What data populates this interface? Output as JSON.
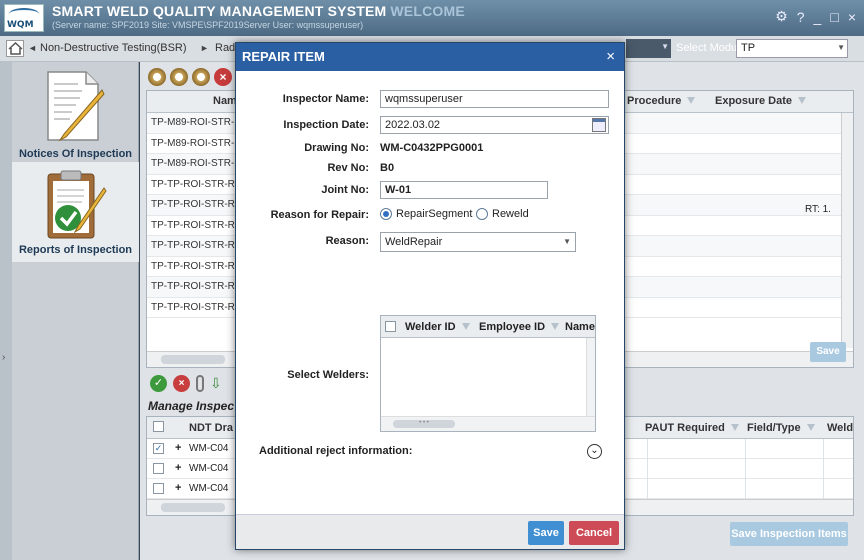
{
  "app": {
    "title": "SMART WELD QUALITY MANAGEMENT SYSTEM",
    "welcome": "WELCOME",
    "server_line": "(Server name: SPF2019 Site: VMSPE\\SPF2019Server User: wqmssuperuser)",
    "logo_text": "WQM",
    "window_controls": [
      "?",
      "_",
      "□",
      "×"
    ]
  },
  "breadcrumb": {
    "items": [
      "Non-Destructive Testing(BSR)",
      "Rad"
    ],
    "select_module_label": "Select Module:",
    "module_value": "TP"
  },
  "sidebar": {
    "items": [
      {
        "label": "Notices Of Inspection",
        "icon": "notice-document-icon"
      },
      {
        "label": "Reports of Inspection",
        "icon": "report-clipboard-icon"
      }
    ]
  },
  "grid1": {
    "columns": [
      "Name",
      "Procedure",
      "Exposure Date"
    ],
    "rows": [
      "TP-M89-ROI-STR-",
      "TP-M89-ROI-STR-",
      "TP-M89-ROI-STR-",
      "TP-TP-ROI-STR-RT",
      "TP-TP-ROI-STR-RT",
      "TP-TP-ROI-STR-RT",
      "TP-TP-ROI-STR-RT",
      "TP-TP-ROI-STR-RT",
      "TP-TP-ROI-STR-RT",
      "TP-TP-ROI-STR-RT"
    ],
    "rt_value": "RT: 1.",
    "save_label": "Save"
  },
  "manage": {
    "title": "Manage Inspec",
    "columns": [
      "NDT Dra",
      "PAUT Required",
      "Field/Type",
      "Weld"
    ],
    "rows": [
      {
        "checked": true,
        "value": "WM-C04"
      },
      {
        "checked": false,
        "value": "WM-C04"
      },
      {
        "checked": false,
        "value": "WM-C04"
      }
    ],
    "save_items_label": "Save Inspection Items"
  },
  "modal": {
    "title": "REPAIR ITEM",
    "inspector_name_label": "Inspector Name:",
    "inspector_name": "wqmssuperuser",
    "inspection_date_label": "Inspection Date:",
    "inspection_date": "2022.03.02",
    "drawing_no_label": "Drawing No:",
    "drawing_no": "WM-C0432PPG0001",
    "rev_no_label": "Rev No:",
    "rev_no": "B0",
    "joint_no_label": "Joint No:",
    "joint_no": "W-01",
    "reason_for_repair_label": "Reason for Repair:",
    "repair_options": [
      "RepairSegment",
      "Reweld"
    ],
    "repair_selected": "RepairSegment",
    "reason_label": "Reason:",
    "reason_value": "WeldRepair",
    "select_welders_label": "Select Welders:",
    "welder_columns": [
      "Welder ID",
      "Employee ID",
      "Name"
    ],
    "additional_label": "Additional reject information:",
    "save_label": "Save",
    "cancel_label": "Cancel"
  }
}
